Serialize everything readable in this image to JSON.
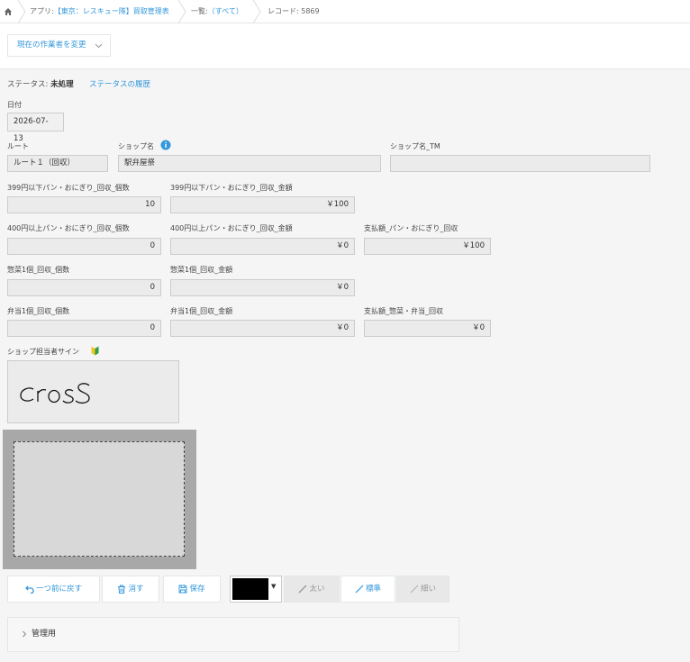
{
  "breadcrumb": {
    "app_prefix": "アプリ:",
    "app_name": "【東京：レスキュー隊】買取管理表",
    "view_prefix": "一覧:",
    "view_name": "（すべて）",
    "record": "レコード: 5869"
  },
  "toolbar": {
    "change_assignee_label": "現在の作業者を変更"
  },
  "status": {
    "label": "ステータス:",
    "value": "未処理",
    "history_link": "ステータスの履歴"
  },
  "form": {
    "date": {
      "label": "日付",
      "value": "2026-07-13"
    },
    "route": {
      "label": "ルート",
      "value": "ルート１（回収）"
    },
    "shop_name": {
      "label": "ショップ名",
      "value": "駅弁屋祭"
    },
    "shop_name_tm": {
      "label": "ショップ名_TM",
      "value": ""
    },
    "bread399_count": {
      "label": "399円以下パン・おにぎり_回収_個数",
      "value": "10"
    },
    "bread399_amount": {
      "label": "399円以下パン・おにぎり_回収_金額",
      "value": "￥100"
    },
    "bread400_count": {
      "label": "400円以上パン・おにぎり_回収_個数",
      "value": "0"
    },
    "bread400_amount": {
      "label": "400円以上パン・おにぎり_回収_金額",
      "value": "￥0"
    },
    "pay_bread": {
      "label": "支払額_パン・おにぎり_回収",
      "value": "￥100"
    },
    "side_count": {
      "label": "惣菜1個_回収_個数",
      "value": "0"
    },
    "side_amount": {
      "label": "惣菜1個_回収_金額",
      "value": "￥0"
    },
    "bento_count": {
      "label": "弁当1個_回収_個数",
      "value": "0"
    },
    "bento_amount": {
      "label": "弁当1個_回収_金額",
      "value": "￥0"
    },
    "pay_side_bento": {
      "label": "支払額_惣菜・弁当_回収",
      "value": "￥0"
    },
    "signature": {
      "label": "ショップ担当者サイン",
      "value": "cross"
    }
  },
  "pad_buttons": {
    "undo": "一つ前に戻す",
    "erase": "消す",
    "save": "保存",
    "thick": "太い",
    "normal": "標準",
    "thin": "細い"
  },
  "pen_color": "#000000",
  "accent_color": "#3498db",
  "section": {
    "title": "管理用"
  },
  "icons": [
    "home-icon",
    "info-icon",
    "beginner-mark-icon",
    "undo-icon",
    "trash-icon",
    "save-icon",
    "pen-icon",
    "chevron-right-icon",
    "chevron-down-icon"
  ]
}
